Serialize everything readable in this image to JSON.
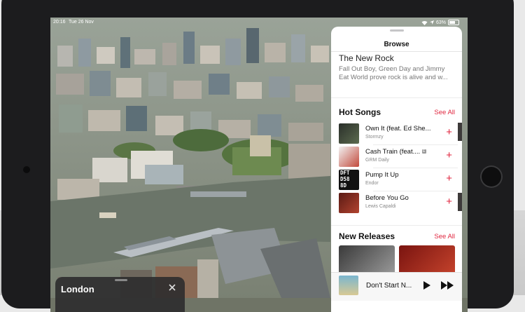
{
  "status_bar": {
    "time": "20:16",
    "date": "Tue 26 Nov",
    "battery": "63%"
  },
  "place_card": {
    "title": "London"
  },
  "panel": {
    "title": "Browse",
    "feature": {
      "title": "The New Rock",
      "line1": "Fall Out Boy, Green Day and Jimmy",
      "line2": "Eat World prove rock is alive and w..."
    },
    "hot_songs": {
      "title": "Hot Songs",
      "see_all": "See All",
      "songs": [
        {
          "title": "Own It (feat. Ed She...",
          "artist": "Stormzy",
          "explicit": false
        },
        {
          "title": "Cash Train (feat....",
          "artist": "GRM Daily",
          "explicit": true,
          "explicit_label": "E"
        },
        {
          "title": "Pump It Up",
          "artist": "Endor",
          "explicit": false
        },
        {
          "title": "Before You Go",
          "artist": "Lewis Capaldi",
          "explicit": false
        }
      ]
    },
    "new_releases": {
      "title": "New Releases",
      "see_all": "See All"
    },
    "mini_player": {
      "title": "Don't Start N..."
    },
    "art_text": [
      "DFT",
      "D58",
      "8D"
    ]
  },
  "colors": {
    "accent": "#e0263f"
  }
}
